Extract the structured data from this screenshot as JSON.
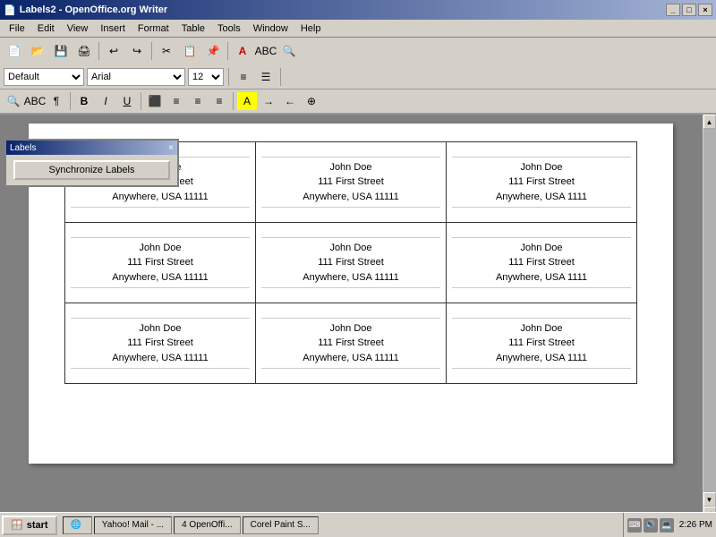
{
  "titleBar": {
    "title": "Labels2 - OpenOffice.org Writer",
    "icon": "📄",
    "btns": [
      "_",
      "□",
      "×"
    ]
  },
  "menuBar": {
    "items": [
      "File",
      "Edit",
      "View",
      "Insert",
      "Format",
      "Table",
      "Tools",
      "Window",
      "Help"
    ]
  },
  "formatToolbar": {
    "style": "Default",
    "font": "Arial",
    "size": "12",
    "bold": "B",
    "italic": "I",
    "underline": "U"
  },
  "syncPanel": {
    "title": "Labels",
    "btnLabel": "Synchronize Labels"
  },
  "labels": {
    "rows": [
      [
        {
          "line1": "John Doe",
          "line2": "111 First Street",
          "line3": "Anywhere, USA 11111"
        },
        {
          "line1": "John Doe",
          "line2": "111 First Street",
          "line3": "Anywhere, USA 11111"
        },
        {
          "line1": "John Doe",
          "line2": "111 First Street",
          "line3": "Anywhere, USA 1111"
        }
      ],
      [
        {
          "line1": "John Doe",
          "line2": "111 First Street",
          "line3": "Anywhere, USA 11111"
        },
        {
          "line1": "John Doe",
          "line2": "111 First Street",
          "line3": "Anywhere, USA 11111"
        },
        {
          "line1": "John Doe",
          "line2": "111 First Street",
          "line3": "Anywhere, USA 1111"
        }
      ],
      [
        {
          "line1": "John Doe",
          "line2": "111 First Street",
          "line3": "Anywhere, USA 11111"
        },
        {
          "line1": "John Doe",
          "line2": "111 First Street",
          "line3": "Anywhere, USA 11111"
        },
        {
          "line1": "John Doe",
          "line2": "111 First Street",
          "line3": "Anywhere, USA 1111"
        }
      ]
    ]
  },
  "taskbar": {
    "startLabel": "start",
    "items": [
      "Yahoo! Mail - ...",
      "4 OpenOffi...",
      "Corel Paint S..."
    ],
    "time": "2:26 PM"
  }
}
